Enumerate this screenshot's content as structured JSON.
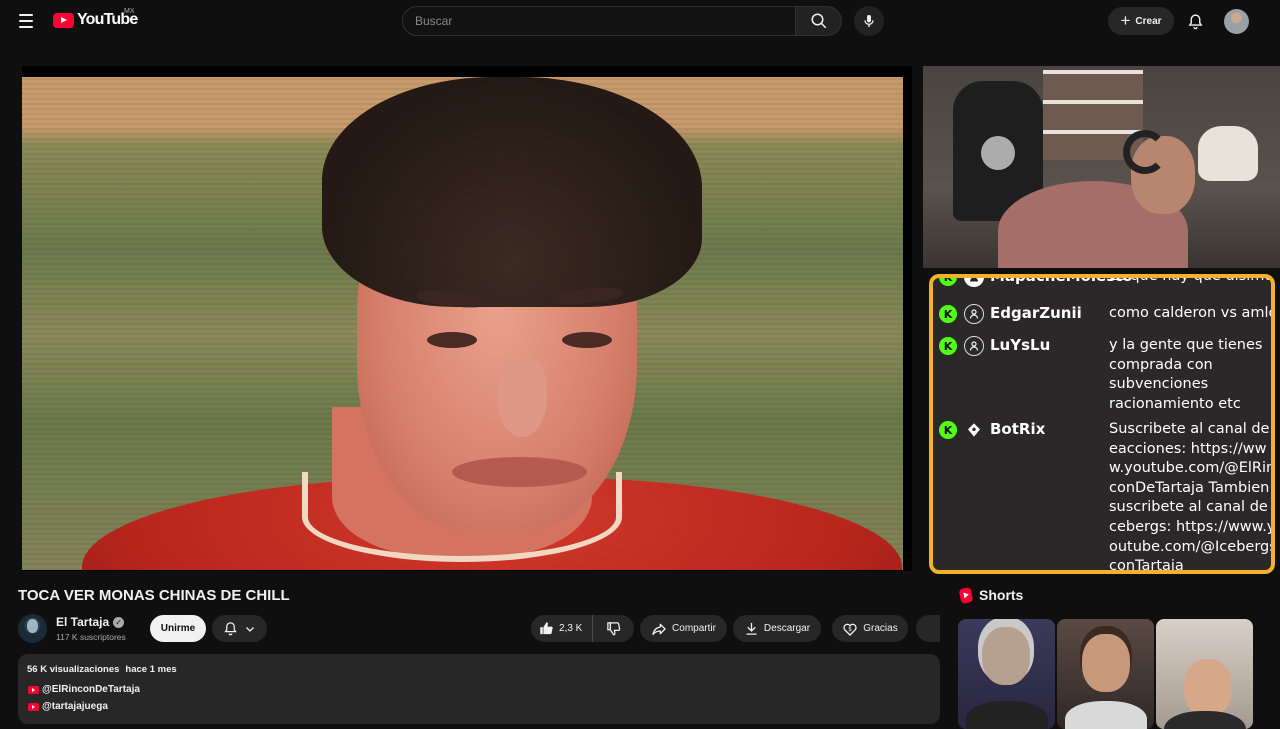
{
  "header": {
    "logo_text": "YouTube",
    "country_code": "MX",
    "search_placeholder": "Buscar",
    "create_label": "Crear",
    "icons": [
      "menu-icon",
      "search-icon",
      "mic-icon",
      "plus-icon",
      "bell-icon"
    ]
  },
  "chat_overlay": {
    "messages": [
      {
        "user": "MapacheMolesto",
        "text": "Es que hay que disimular"
      },
      {
        "user": "EdgarZunii",
        "text": "como calderon vs amlo"
      },
      {
        "user": "LuYsLu",
        "text": "y la gente que tienes comprada con subvenciones racionamiento etc"
      },
      {
        "user": "BotRix",
        "text": "Suscribete al canal de reacciones: https://www.youtube.com/@ElRinconDeTartaja Tambien suscribete al canal de icebergs: https://www.youtube.com/@IcebergsconTartaja"
      }
    ],
    "border_color": "#f4b229",
    "badge_letter": "K",
    "badge_color": "#53fc18"
  },
  "video": {
    "title": "TOCA VER MONAS CHINAS DE CHILL"
  },
  "channel": {
    "name": "El Tartaja",
    "subscribers": "117 K suscriptores",
    "join_label": "Unirme"
  },
  "actions": {
    "likes": "2,3 K",
    "share_label": "Compartir",
    "download_label": "Descargar",
    "thanks_label": "Gracias"
  },
  "description": {
    "views": "56 K visualizaciones",
    "date": "hace 1 mes",
    "links": [
      "@ElRinconDeTartaja",
      "@tartajajuega"
    ]
  },
  "shorts": {
    "title": "Shorts"
  }
}
